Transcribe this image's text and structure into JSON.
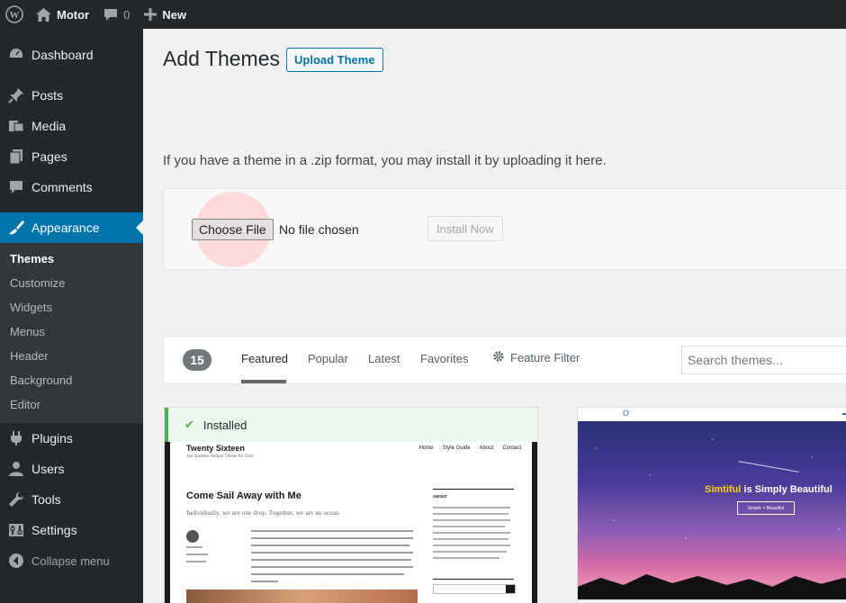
{
  "adminbar": {
    "site_name": "Motor",
    "comments_count": "0",
    "new_label": "New"
  },
  "sidebar": {
    "items": [
      {
        "label": "Dashboard",
        "icon": "dashboard-icon"
      },
      {
        "label": "Posts",
        "icon": "pushpin-icon"
      },
      {
        "label": "Media",
        "icon": "media-icon"
      },
      {
        "label": "Pages",
        "icon": "pages-icon"
      },
      {
        "label": "Comments",
        "icon": "comment-icon"
      },
      {
        "label": "Appearance",
        "icon": "paintbrush-icon"
      },
      {
        "label": "Plugins",
        "icon": "plug-icon"
      },
      {
        "label": "Users",
        "icon": "user-icon"
      },
      {
        "label": "Tools",
        "icon": "wrench-icon"
      },
      {
        "label": "Settings",
        "icon": "sliders-icon"
      }
    ],
    "appearance_sub": [
      "Themes",
      "Customize",
      "Widgets",
      "Menus",
      "Header",
      "Background",
      "Editor"
    ],
    "collapse_label": "Collapse menu"
  },
  "main": {
    "title": "Add Themes",
    "upload_button": "Upload Theme",
    "upload_help": "If you have a theme in a .zip format, you may install it by uploading it here.",
    "choose_file": "Choose File",
    "no_file": "No file chosen",
    "install_now": "Install Now"
  },
  "filter": {
    "count": "15",
    "tabs": [
      "Featured",
      "Popular",
      "Latest",
      "Favorites"
    ],
    "feature_filter": "Feature Filter",
    "search_placeholder": "Search themes..."
  },
  "themes": {
    "installed_label": "Installed",
    "card1": {
      "site_title": "Twenty Sixteen",
      "site_tagline": "Just Another Default Theme for 2016",
      "nav": [
        "Home",
        "Style Guide",
        "About",
        "Contact"
      ],
      "post_title": "Come Sail Away with Me",
      "post_subtitle": "Individually, we are one drop. Together, we are an ocean.",
      "sidebar_heading": "ABOUT"
    },
    "card2": {
      "headline_highlight": "Simtiful",
      "headline_rest": " is Simply Beautiful",
      "button": "Simple + Beautiful"
    }
  },
  "colors": {
    "adminbar": "#23282d",
    "accent": "#0073aa",
    "installed_green": "#46b450"
  }
}
